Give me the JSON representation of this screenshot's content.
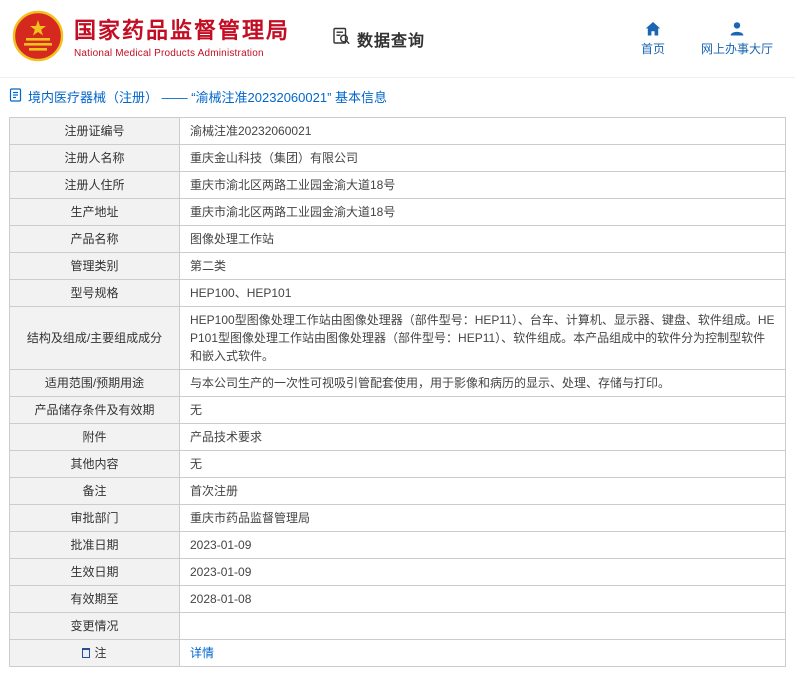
{
  "header": {
    "agency_name_cn": "国家药品监督管理局",
    "agency_name_en": "National Medical Products Administration",
    "section_title": "数据查询",
    "nav": [
      {
        "label": "首页"
      },
      {
        "label": "网上办事大厅"
      }
    ]
  },
  "breadcrumb": {
    "text": "境内医疗器械（注册） ——  “渝械注准20232060021” 基本信息"
  },
  "table": {
    "rows": [
      {
        "label": "注册证编号",
        "value": "渝械注准20232060021"
      },
      {
        "label": "注册人名称",
        "value": "重庆金山科技（集团）有限公司"
      },
      {
        "label": "注册人住所",
        "value": "重庆市渝北区两路工业园金渝大道18号"
      },
      {
        "label": "生产地址",
        "value": "重庆市渝北区两路工业园金渝大道18号"
      },
      {
        "label": "产品名称",
        "value": "图像处理工作站"
      },
      {
        "label": "管理类别",
        "value": "第二类"
      },
      {
        "label": "型号规格",
        "value": "HEP100、HEP101"
      },
      {
        "label": "结构及组成/主要组成成分",
        "value": "HEP100型图像处理工作站由图像处理器（部件型号：HEP11）、台车、计算机、显示器、键盘、软件组成。HEP101型图像处理工作站由图像处理器（部件型号：HEP11）、软件组成。本产品组成中的软件分为控制型软件和嵌入式软件。"
      },
      {
        "label": "适用范围/预期用途",
        "value": "与本公司生产的一次性可视吸引管配套使用，用于影像和病历的显示、处理、存储与打印。"
      },
      {
        "label": "产品储存条件及有效期",
        "value": "无"
      },
      {
        "label": "附件",
        "value": "产品技术要求"
      },
      {
        "label": "其他内容",
        "value": "无"
      },
      {
        "label": "备注",
        "value": "首次注册"
      },
      {
        "label": "审批部门",
        "value": "重庆市药品监督管理局"
      },
      {
        "label": "批准日期",
        "value": "2023-01-09"
      },
      {
        "label": "生效日期",
        "value": "2023-01-09"
      },
      {
        "label": "有效期至",
        "value": "2028-01-08"
      },
      {
        "label": "变更情况",
        "value": ""
      },
      {
        "label": "注",
        "value": "详情",
        "link": true,
        "label_icon": "note-icon"
      }
    ]
  },
  "colors": {
    "brand_red": "#c30d23",
    "nav_blue": "#1a66b3",
    "link_blue": "#0066cc",
    "label_bg": "#f2f2f2",
    "border": "#cccccc"
  }
}
